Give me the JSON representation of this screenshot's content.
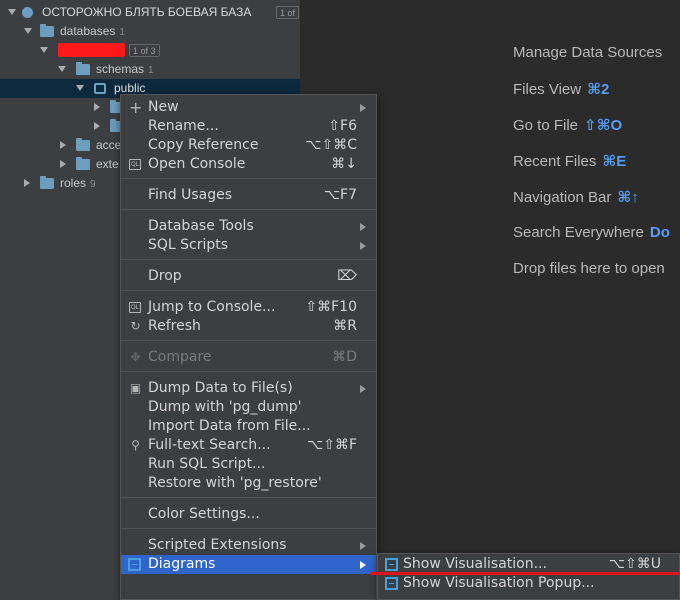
{
  "tree": {
    "root": {
      "label": "ОСТОРОЖНО БЛЯТЬ БОЕВАЯ БАЗА",
      "badge": "1 of"
    },
    "databases": {
      "label": "databases",
      "count": "1"
    },
    "db": {
      "badge": "1 of 3"
    },
    "schemas": {
      "label": "schemas",
      "count": "1"
    },
    "public": {
      "label": "public"
    },
    "access": {
      "label": "acce"
    },
    "extensions": {
      "label": "exte"
    },
    "roles": {
      "label": "roles",
      "count": "9"
    }
  },
  "welcome": {
    "items": [
      {
        "label": "Manage Data Sources",
        "shortcut": ""
      },
      {
        "label": "Files View",
        "shortcut": "⌘2"
      },
      {
        "label": "Go to File",
        "shortcut": "⇧⌘O"
      },
      {
        "label": "Recent Files",
        "shortcut": "⌘E"
      },
      {
        "label": "Navigation Bar",
        "shortcut": "⌘↑"
      },
      {
        "label": "Search Everywhere",
        "shortcut": "Do"
      },
      {
        "label": "Drop files here to open",
        "shortcut": ""
      }
    ]
  },
  "menu": {
    "new": {
      "label": "New"
    },
    "rename": {
      "label": "Rename...",
      "shortcut": "⇧F6"
    },
    "copy_reference": {
      "label": "Copy Reference",
      "shortcut": "⌥⇧⌘C"
    },
    "open_console": {
      "label": "Open Console",
      "shortcut": "⌘↓"
    },
    "find_usages": {
      "label": "Find Usages",
      "shortcut": "⌥F7"
    },
    "database_tools": {
      "label": "Database Tools"
    },
    "sql_scripts": {
      "label": "SQL Scripts"
    },
    "drop": {
      "label": "Drop",
      "shortcut": "⌦"
    },
    "jump_to_console": {
      "label": "Jump to Console...",
      "shortcut": "⇧⌘F10"
    },
    "refresh": {
      "label": "Refresh",
      "shortcut": "⌘R"
    },
    "compare": {
      "label": "Compare",
      "shortcut": "⌘D"
    },
    "dump_data": {
      "label": "Dump Data to File(s)"
    },
    "dump_pg": {
      "label": "Dump with 'pg_dump'"
    },
    "import_data": {
      "label": "Import Data from File..."
    },
    "fulltext_search": {
      "label": "Full-text Search...",
      "shortcut": "⌥⇧⌘F"
    },
    "run_sql": {
      "label": "Run SQL Script..."
    },
    "restore": {
      "label": "Restore with 'pg_restore'"
    },
    "color_settings": {
      "label": "Color Settings..."
    },
    "scripted_extensions": {
      "label": "Scripted Extensions"
    },
    "diagrams": {
      "label": "Diagrams"
    },
    "icon_text": {
      "console": "QL"
    }
  },
  "submenu": {
    "show_vis": {
      "label": "Show Visualisation...",
      "shortcut": "⌥⇧⌘U"
    },
    "show_vis_popup": {
      "label": "Show Visualisation Popup..."
    }
  },
  "colors": {
    "accent": "#2f65ca",
    "highlight_red": "#e0131a",
    "shortcut_blue": "#589df6"
  }
}
